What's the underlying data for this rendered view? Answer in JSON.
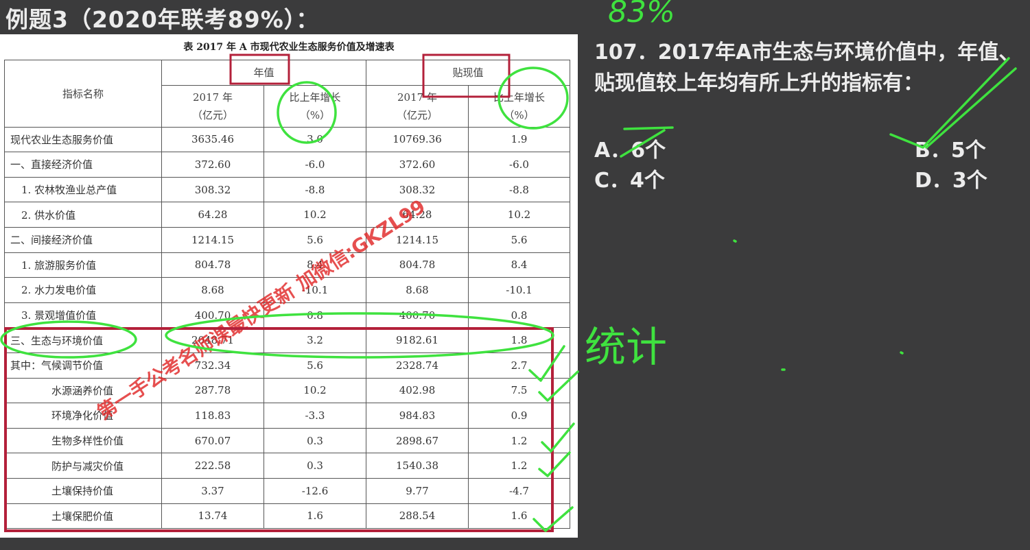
{
  "heading": "例题3（2020年联考89%）：",
  "table": {
    "title": "表   2017 年 A 市现代农业生态服务价值及增速表",
    "headers": {
      "name": "指标名称",
      "annual_group": "年值",
      "discount_group": "贴现值",
      "value_col": "2017 年",
      "value_unit": "（亿元）",
      "growth_col": "比上年增长",
      "growth_unit": "（%）"
    },
    "rows": [
      {
        "name": "现代农业生态服务价值",
        "annual": "3635.46",
        "annual_growth": "3.0",
        "discount": "10769.36",
        "discount_growth": "1.9"
      },
      {
        "name": "一、直接经济价值",
        "annual": "372.60",
        "annual_growth": "-6.0",
        "discount": "372.60",
        "discount_growth": "-6.0"
      },
      {
        "name": "1. 农林牧渔业总产值",
        "annual": "308.32",
        "annual_growth": "-8.8",
        "discount": "308.32",
        "discount_growth": "-8.8"
      },
      {
        "name": "2. 供水价值",
        "annual": "64.28",
        "annual_growth": "10.2",
        "discount": "64.28",
        "discount_growth": "10.2"
      },
      {
        "name": "二、间接经济价值",
        "annual": "1214.15",
        "annual_growth": "5.6",
        "discount": "1214.15",
        "discount_growth": "5.6"
      },
      {
        "name": "1. 旅游服务价值",
        "annual": "804.78",
        "annual_growth": "8.4",
        "discount": "804.78",
        "discount_growth": "8.4"
      },
      {
        "name": "2. 水力发电价值",
        "annual": "8.68",
        "annual_growth": "-10.1",
        "discount": "8.68",
        "discount_growth": "-10.1"
      },
      {
        "name": "3. 景观增值价值",
        "annual": "400.70",
        "annual_growth": "0.8",
        "discount": "400.70",
        "discount_growth": "0.8"
      },
      {
        "name": "三、生态与环境价值",
        "annual": "2048.71",
        "annual_growth": "3.2",
        "discount": "9182.61",
        "discount_growth": "1.8"
      },
      {
        "name": "其中：气候调节价值",
        "annual": "732.34",
        "annual_growth": "5.6",
        "discount": "2328.74",
        "discount_growth": "2.7"
      },
      {
        "name": "水源涵养价值",
        "annual": "287.78",
        "annual_growth": "10.2",
        "discount": "402.98",
        "discount_growth": "7.5"
      },
      {
        "name": "环境净化价值",
        "annual": "118.83",
        "annual_growth": "-3.3",
        "discount": "984.83",
        "discount_growth": "0.9"
      },
      {
        "name": "生物多样性价值",
        "annual": "670.07",
        "annual_growth": "0.3",
        "discount": "2898.67",
        "discount_growth": "1.2"
      },
      {
        "name": "防护与减灾价值",
        "annual": "222.58",
        "annual_growth": "0.3",
        "discount": "1540.38",
        "discount_growth": "1.2"
      },
      {
        "name": "土壤保持价值",
        "annual": "3.37",
        "annual_growth": "-12.6",
        "discount": "9.77",
        "discount_growth": "-4.7"
      },
      {
        "name": "土壤保肥价值",
        "annual": "13.74",
        "annual_growth": "1.6",
        "discount": "288.54",
        "discount_growth": "1.6"
      }
    ]
  },
  "question": {
    "text": "107．2017年A市生态与环境价值中，年值、贴现值较上年均有所上升的指标有：",
    "options": {
      "A": "A．6个",
      "B": "B．5个",
      "C": "C．4个",
      "D": "D．3个"
    }
  },
  "handwriting": {
    "top_note": "83%",
    "side_note": "统计",
    "color": "#3fe23f"
  },
  "watermark": "第一手公考名师课最快更新 加微信:GKZL99",
  "colors": {
    "box": "#b3203a",
    "ink": "#3fe23f",
    "watermark": "#e02828"
  }
}
